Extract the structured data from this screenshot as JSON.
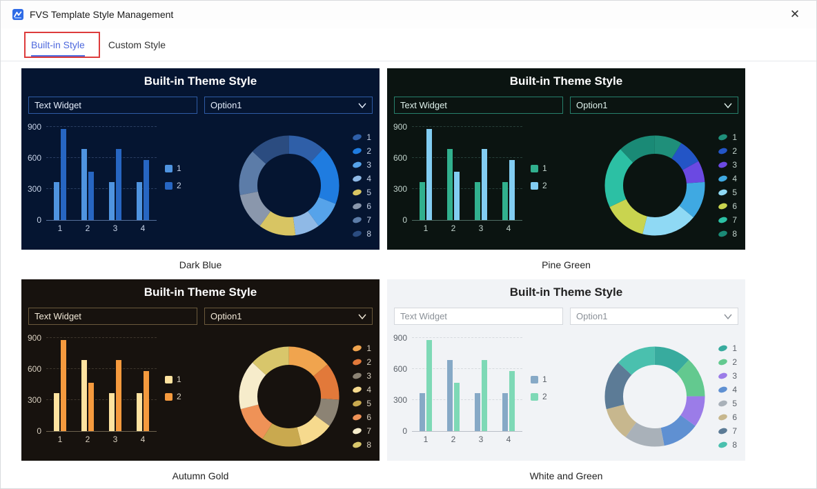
{
  "window": {
    "title": "FVS Template Style Management",
    "close_label": "✕"
  },
  "tabs": [
    {
      "label": "Built-in Style",
      "active": true
    },
    {
      "label": "Custom Style",
      "active": false
    }
  ],
  "annotations": {
    "highlighted_tab": "Built-in Style",
    "color": "#dd3b3b"
  },
  "card_common": {
    "title": "Built-in Theme Style",
    "text_widget_value": "Text Widget",
    "dropdown_value": "Option1"
  },
  "chart_data": [
    {
      "theme": "Dark Blue",
      "bar": {
        "type": "bar",
        "categories": [
          "1",
          "2",
          "3",
          "4"
        ],
        "series": [
          {
            "name": "1",
            "values": [
              370,
              690,
              370,
              370
            ]
          },
          {
            "name": "2",
            "values": [
              880,
              470,
              690,
              580
            ]
          }
        ],
        "ylim": [
          0,
          900
        ],
        "yticks": [
          0,
          300,
          600,
          900
        ],
        "grid": "dashed",
        "legend_position": "right"
      },
      "donut": {
        "type": "pie",
        "labels": [
          "1",
          "2",
          "3",
          "4",
          "5",
          "6",
          "7",
          "8"
        ],
        "values": [
          12,
          19,
          9,
          8,
          12,
          12,
          15,
          13
        ],
        "legend_position": "right"
      }
    },
    {
      "theme": "Pine Green",
      "bar": {
        "type": "bar",
        "categories": [
          "1",
          "2",
          "3",
          "4"
        ],
        "series": [
          {
            "name": "1",
            "values": [
              370,
              690,
              370,
              370
            ]
          },
          {
            "name": "2",
            "values": [
              880,
              470,
              690,
              580
            ]
          }
        ],
        "ylim": [
          0,
          900
        ],
        "yticks": [
          0,
          300,
          600,
          900
        ],
        "grid": "dashed",
        "legend_position": "right"
      },
      "donut": {
        "type": "pie",
        "labels": [
          "1",
          "2",
          "3",
          "4",
          "5",
          "6",
          "7",
          "8"
        ],
        "values": [
          9,
          8,
          7,
          12,
          18,
          14,
          20,
          12
        ],
        "legend_position": "right"
      }
    },
    {
      "theme": "Autumn Gold",
      "bar": {
        "type": "bar",
        "categories": [
          "1",
          "2",
          "3",
          "4"
        ],
        "series": [
          {
            "name": "1",
            "values": [
              370,
              690,
              370,
              370
            ]
          },
          {
            "name": "2",
            "values": [
              880,
              470,
              690,
              580
            ]
          }
        ],
        "ylim": [
          0,
          900
        ],
        "yticks": [
          0,
          300,
          600,
          900
        ],
        "grid": "dashed",
        "legend_position": "right"
      },
      "donut": {
        "type": "pie",
        "labels": [
          "1",
          "2",
          "3",
          "4",
          "5",
          "6",
          "7",
          "8"
        ],
        "values": [
          14,
          12,
          9,
          11,
          13,
          12,
          16,
          13
        ],
        "legend_position": "right"
      }
    },
    {
      "theme": "White and Green",
      "bar": {
        "type": "bar",
        "categories": [
          "1",
          "2",
          "3",
          "4"
        ],
        "series": [
          {
            "name": "1",
            "values": [
              370,
              690,
              370,
              370
            ]
          },
          {
            "name": "2",
            "values": [
              880,
              470,
              690,
              580
            ]
          }
        ],
        "ylim": [
          0,
          900
        ],
        "yticks": [
          0,
          300,
          600,
          900
        ],
        "grid": "dashed",
        "legend_position": "right"
      },
      "donut": {
        "type": "pie",
        "labels": [
          "1",
          "2",
          "3",
          "4",
          "5",
          "6",
          "7",
          "8"
        ],
        "values": [
          12,
          13,
          10,
          12,
          13,
          11,
          16,
          13
        ],
        "legend_position": "right"
      }
    }
  ],
  "themes": [
    {
      "name": "Dark Blue",
      "colors": {
        "card_bg": "#051531",
        "title": "#ffffff",
        "ctl_border": "#2e5ba6",
        "ctl_text": "#e6eefc",
        "ctl_bg": "transparent",
        "axis_text": "#c5d1e6",
        "grid": "#2b3f63",
        "axis_line": "#55709c",
        "bars": [
          "#4f94e0",
          "#2766c2"
        ],
        "donut": [
          "#2f5fa8",
          "#1f7ce0",
          "#56a3ea",
          "#8fb9e6",
          "#d8c563",
          "#8a97ac",
          "#5c7ca8",
          "#2b4c80"
        ]
      }
    },
    {
      "name": "Pine Green",
      "colors": {
        "card_bg": "#0b1411",
        "title": "#ffffff",
        "ctl_border": "#27806c",
        "ctl_text": "#dff2ec",
        "ctl_bg": "transparent",
        "axis_text": "#c2d4cd",
        "grid": "#28403a",
        "axis_line": "#4f6e65",
        "bars": [
          "#31b08e",
          "#82cdf2"
        ],
        "donut": [
          "#1f8f7a",
          "#2355c6",
          "#6b49e2",
          "#3fa9e2",
          "#8fd9f4",
          "#c9d44f",
          "#2cc0a4",
          "#1a8a76"
        ]
      }
    },
    {
      "name": "Autumn Gold",
      "colors": {
        "card_bg": "#17120e",
        "title": "#ffffff",
        "ctl_border": "#6b5a3c",
        "ctl_text": "#f2e9d8",
        "ctl_bg": "transparent",
        "axis_text": "#d8cfbf",
        "grid": "#3f382e",
        "axis_line": "#6e6450",
        "bars": [
          "#ffe3a0",
          "#f59a3e"
        ],
        "donut": [
          "#f0a44e",
          "#e2793a",
          "#8c8374",
          "#f6da8e",
          "#c9a94f",
          "#ef9257",
          "#f6eccb",
          "#d8c66b"
        ]
      }
    },
    {
      "name": "White and Green",
      "colors": {
        "card_bg": "#f1f3f6",
        "title": "#222222",
        "ctl_border": "#d4d7dc",
        "ctl_text": "#8a9097",
        "ctl_bg": "#ffffff",
        "axis_text": "#5a6068",
        "grid": "#d6dade",
        "axis_line": "#b8bec6",
        "bars": [
          "#86a9c6",
          "#7ed9b6"
        ],
        "donut": [
          "#38ab9e",
          "#63c98f",
          "#9b7ce8",
          "#5f90d2",
          "#a9b1b9",
          "#c7b78e",
          "#5c7b96",
          "#4ac0ae"
        ]
      }
    }
  ]
}
